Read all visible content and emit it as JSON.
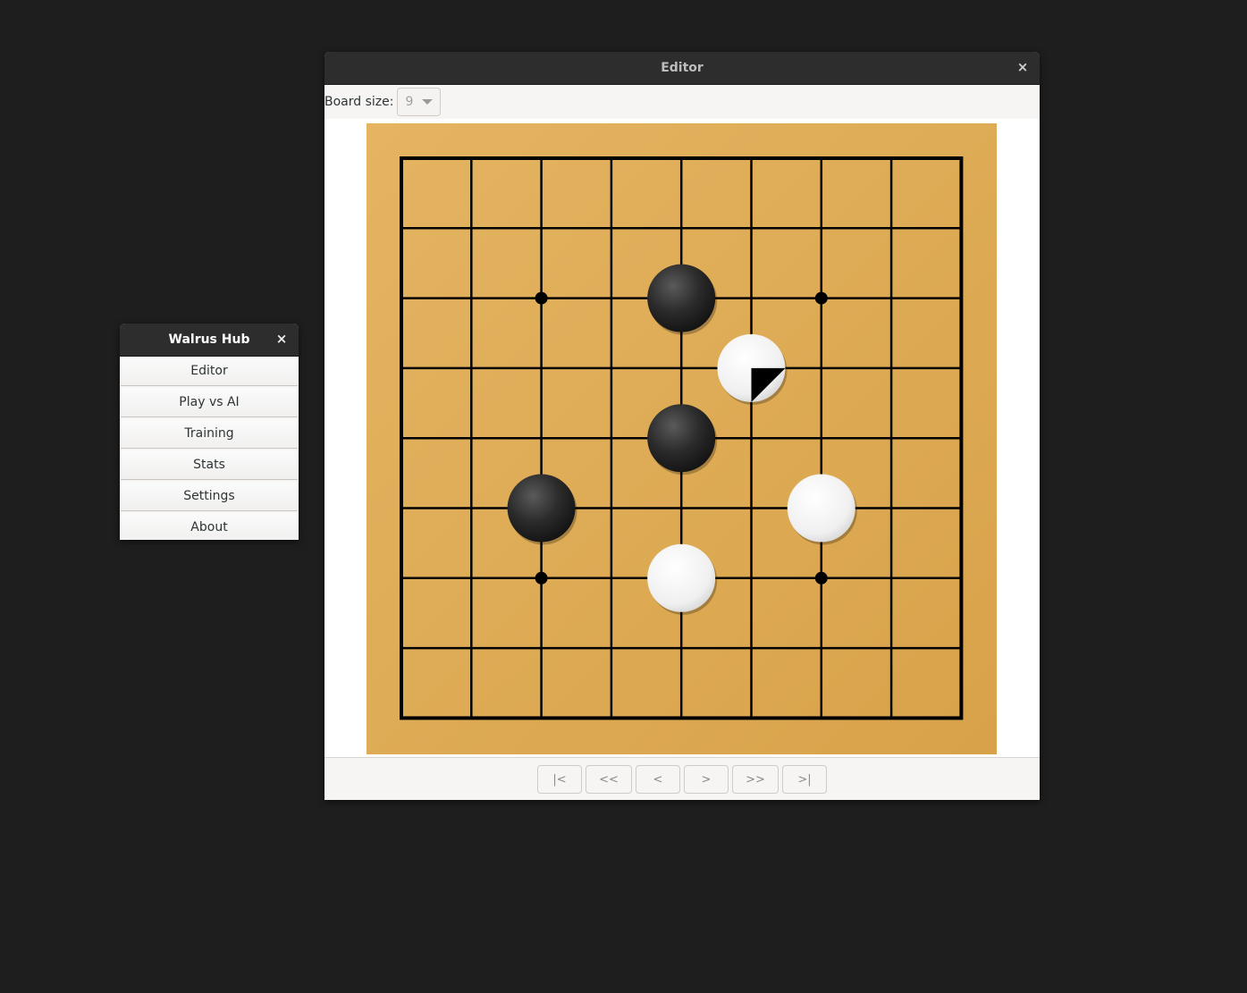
{
  "hub": {
    "title": "Walrus Hub",
    "close_glyph": "×",
    "items": [
      {
        "label": "Editor"
      },
      {
        "label": "Play vs AI"
      },
      {
        "label": "Training"
      },
      {
        "label": "Stats"
      },
      {
        "label": "Settings"
      },
      {
        "label": "About"
      }
    ]
  },
  "editor": {
    "title": "Editor",
    "close_glyph": "×",
    "board_size_label": "Board size:",
    "board_size_value": "9",
    "nav": {
      "first": "|<",
      "back_many": "<<",
      "back": "<",
      "forward": ">",
      "forward_many": ">>",
      "last": ">|"
    }
  },
  "board": {
    "size": 9,
    "hoshi": [
      [
        2,
        2
      ],
      [
        6,
        2
      ],
      [
        2,
        6
      ],
      [
        6,
        6
      ]
    ],
    "stones": [
      {
        "color": "black",
        "col": 4,
        "row": 2
      },
      {
        "color": "white",
        "col": 5,
        "row": 3,
        "last_move": true
      },
      {
        "color": "black",
        "col": 4,
        "row": 4
      },
      {
        "color": "black",
        "col": 2,
        "row": 5
      },
      {
        "color": "white",
        "col": 6,
        "row": 5
      },
      {
        "color": "white",
        "col": 4,
        "row": 6
      }
    ],
    "colors": {
      "wood_light": "#e4b461",
      "wood_dark": "#d8a24a",
      "line": "#000000",
      "black_stone": "#2a2a2a",
      "white_stone": "#f2f2f2"
    }
  }
}
